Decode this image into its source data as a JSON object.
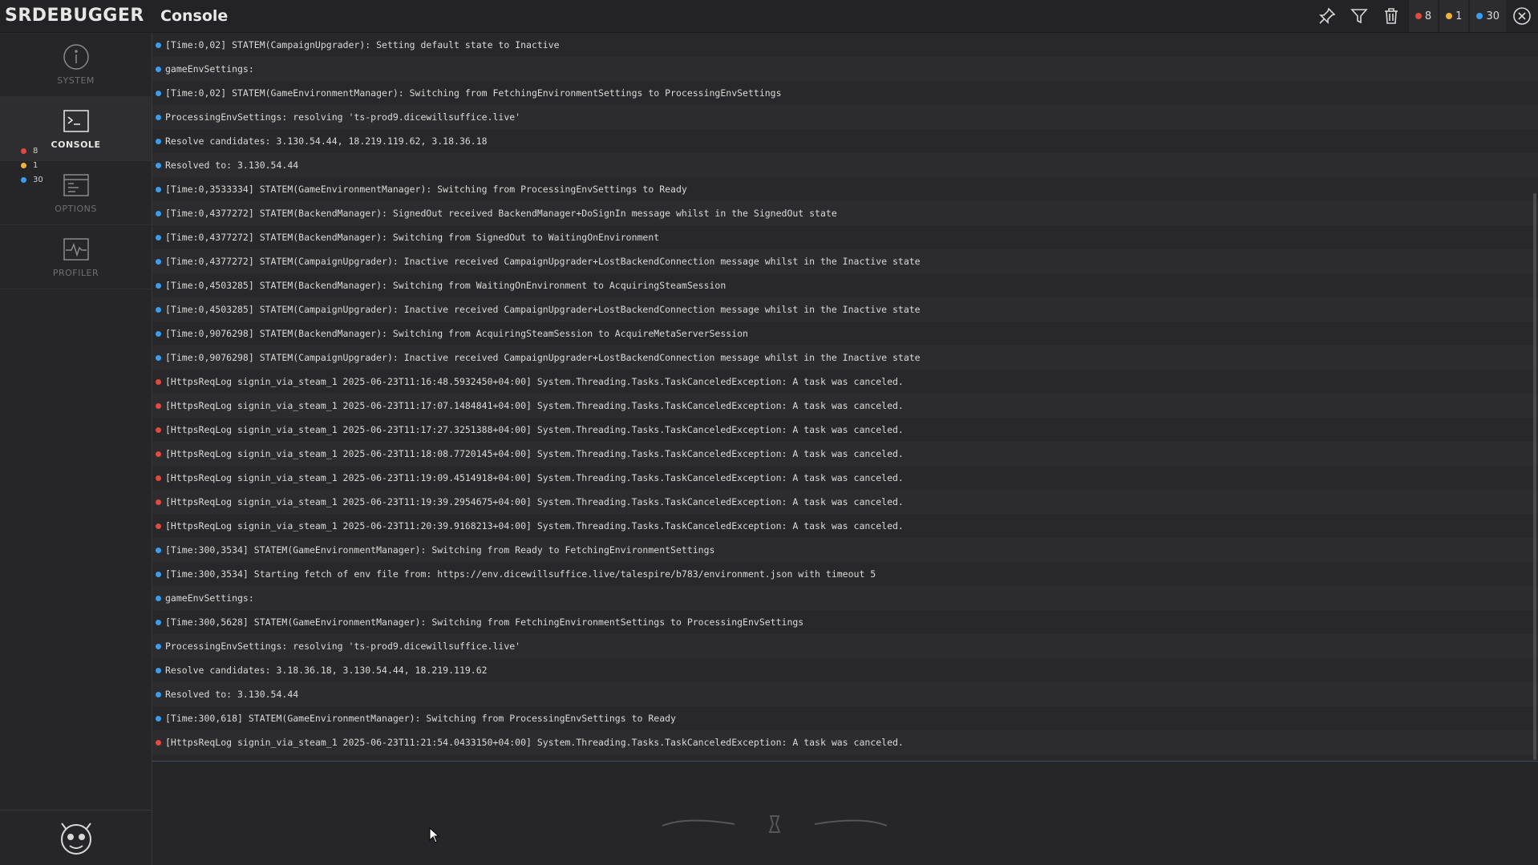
{
  "app": {
    "logo": "SRDEBUGGER",
    "title": "Console"
  },
  "toolbar": {
    "counts": {
      "error": "8",
      "warning": "1",
      "info": "30"
    }
  },
  "sidebar": {
    "tabs": [
      {
        "label": "SYSTEM",
        "icon": "info-icon"
      },
      {
        "label": "CONSOLE",
        "icon": "terminal-icon",
        "active": true
      },
      {
        "label": "OPTIONS",
        "icon": "options-icon"
      },
      {
        "label": "PROFILER",
        "icon": "profiler-icon"
      }
    ],
    "counts": {
      "error": "8",
      "warning": "1",
      "info": "30"
    }
  },
  "colors": {
    "error": "#e04a3f",
    "warning": "#f0b23a",
    "info": "#3a9ef0"
  },
  "log": [
    {
      "level": "info",
      "text": "[Time:0,02] STATEM(CampaignUpgrader): Setting default state to Inactive"
    },
    {
      "level": "info",
      "text": "gameEnvSettings:"
    },
    {
      "level": "info",
      "text": "[Time:0,02] STATEM(GameEnvironmentManager): Switching from FetchingEnvironmentSettings to ProcessingEnvSettings"
    },
    {
      "level": "info",
      "text": "ProcessingEnvSettings: resolving 'ts-prod9.dicewillsuffice.live'"
    },
    {
      "level": "info",
      "text": "Resolve candidates: 3.130.54.44, 18.219.119.62, 3.18.36.18"
    },
    {
      "level": "info",
      "text": "Resolved to: 3.130.54.44"
    },
    {
      "level": "info",
      "text": "[Time:0,3533334] STATEM(GameEnvironmentManager): Switching from ProcessingEnvSettings to Ready"
    },
    {
      "level": "info",
      "text": "[Time:0,4377272] STATEM(BackendManager): SignedOut received BackendManager+DoSignIn message whilst in the SignedOut state"
    },
    {
      "level": "info",
      "text": "[Time:0,4377272] STATEM(BackendManager): Switching from SignedOut to WaitingOnEnvironment"
    },
    {
      "level": "info",
      "text": "[Time:0,4377272] STATEM(CampaignUpgrader): Inactive received CampaignUpgrader+LostBackendConnection message whilst in the Inactive state"
    },
    {
      "level": "info",
      "text": "[Time:0,4503285] STATEM(BackendManager): Switching from WaitingOnEnvironment to AcquiringSteamSession"
    },
    {
      "level": "info",
      "text": "[Time:0,4503285] STATEM(CampaignUpgrader): Inactive received CampaignUpgrader+LostBackendConnection message whilst in the Inactive state"
    },
    {
      "level": "info",
      "text": "[Time:0,9076298] STATEM(BackendManager): Switching from AcquiringSteamSession to AcquireMetaServerSession"
    },
    {
      "level": "info",
      "text": "[Time:0,9076298] STATEM(CampaignUpgrader): Inactive received CampaignUpgrader+LostBackendConnection message whilst in the Inactive state"
    },
    {
      "level": "error",
      "text": "[HttpsReqLog signin_via_steam_1 2025-06-23T11:16:48.5932450+04:00] System.Threading.Tasks.TaskCanceledException: A task was canceled."
    },
    {
      "level": "error",
      "text": "[HttpsReqLog signin_via_steam_1 2025-06-23T11:17:07.1484841+04:00] System.Threading.Tasks.TaskCanceledException: A task was canceled."
    },
    {
      "level": "error",
      "text": "[HttpsReqLog signin_via_steam_1 2025-06-23T11:17:27.3251388+04:00] System.Threading.Tasks.TaskCanceledException: A task was canceled."
    },
    {
      "level": "error",
      "text": "[HttpsReqLog signin_via_steam_1 2025-06-23T11:18:08.7720145+04:00] System.Threading.Tasks.TaskCanceledException: A task was canceled."
    },
    {
      "level": "error",
      "text": "[HttpsReqLog signin_via_steam_1 2025-06-23T11:19:09.4514918+04:00] System.Threading.Tasks.TaskCanceledException: A task was canceled."
    },
    {
      "level": "error",
      "text": "[HttpsReqLog signin_via_steam_1 2025-06-23T11:19:39.2954675+04:00] System.Threading.Tasks.TaskCanceledException: A task was canceled."
    },
    {
      "level": "error",
      "text": "[HttpsReqLog signin_via_steam_1 2025-06-23T11:20:39.9168213+04:00] System.Threading.Tasks.TaskCanceledException: A task was canceled."
    },
    {
      "level": "info",
      "text": "[Time:300,3534] STATEM(GameEnvironmentManager): Switching from Ready to FetchingEnvironmentSettings"
    },
    {
      "level": "info",
      "text": "[Time:300,3534] Starting fetch of env file from: https://env.dicewillsuffice.live/talespire/b783/environment.json with timeout 5"
    },
    {
      "level": "info",
      "text": "gameEnvSettings:"
    },
    {
      "level": "info",
      "text": "[Time:300,5628] STATEM(GameEnvironmentManager): Switching from FetchingEnvironmentSettings to ProcessingEnvSettings"
    },
    {
      "level": "info",
      "text": "ProcessingEnvSettings: resolving 'ts-prod9.dicewillsuffice.live'"
    },
    {
      "level": "info",
      "text": "Resolve candidates: 3.18.36.18, 3.130.54.44, 18.219.119.62"
    },
    {
      "level": "info",
      "text": "Resolved to: 3.130.54.44"
    },
    {
      "level": "info",
      "text": "[Time:300,618] STATEM(GameEnvironmentManager): Switching from ProcessingEnvSettings to Ready"
    },
    {
      "level": "error",
      "text": "[HttpsReqLog signin_via_steam_1 2025-06-23T11:21:54.0433150+04:00] System.Threading.Tasks.TaskCanceledException: A task was canceled."
    }
  ]
}
